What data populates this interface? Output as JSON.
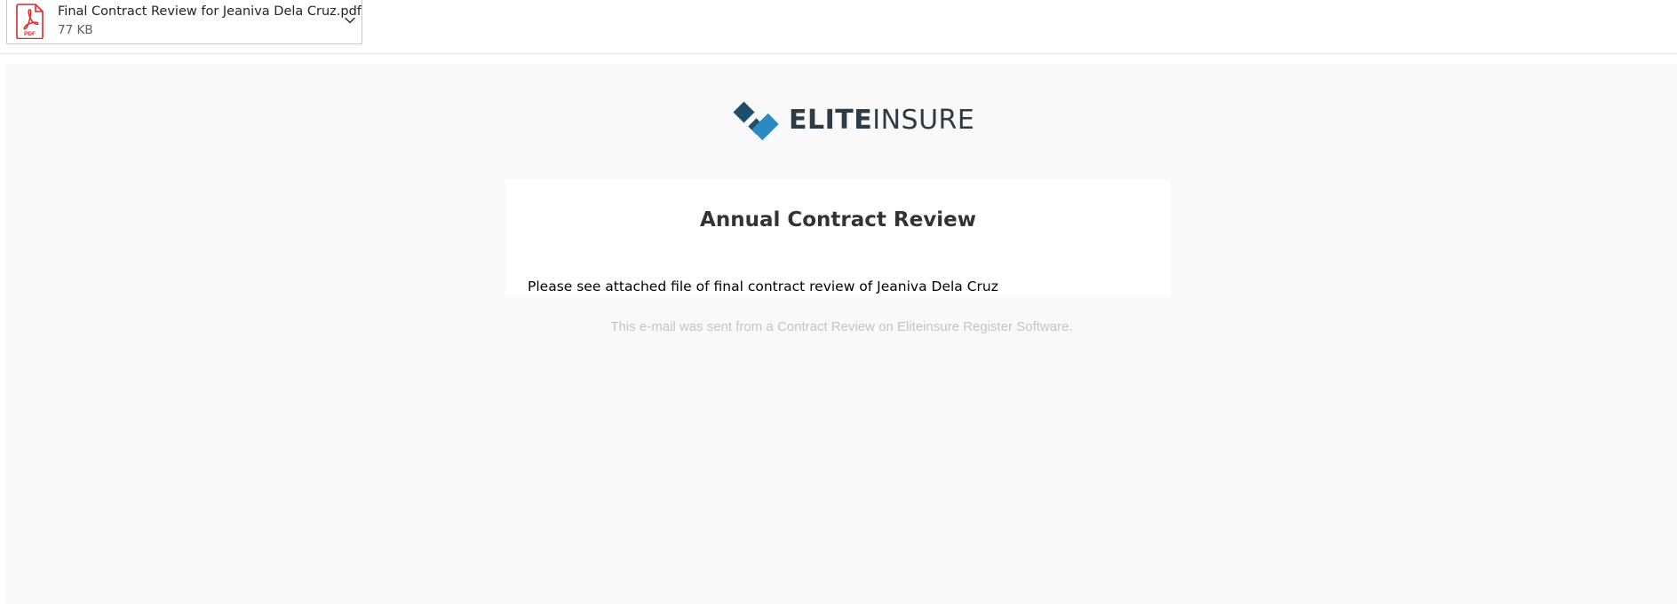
{
  "attachment": {
    "file_name": "Final Contract Review for Jeaniva Dela Cruz.pdf",
    "file_size": "77 KB",
    "icon": "pdf-icon",
    "icon_label": "PDF",
    "icon_color": "#d92b2b",
    "menu_icon": "chevron-down-icon"
  },
  "email": {
    "background_color": "#f9f9f9",
    "logo": {
      "text_bold": "ELITE",
      "text_light": "INSURE",
      "mark_colors": [
        "#1d4e6e",
        "#2b8ac4"
      ]
    },
    "card": {
      "title": "Annual Contract Review",
      "message": "Please see attached file of final contract review of Jeaniva Dela Cruz"
    },
    "footer_note": "This e-mail was sent from a Contract Review on Eliteinsure Register Software."
  }
}
